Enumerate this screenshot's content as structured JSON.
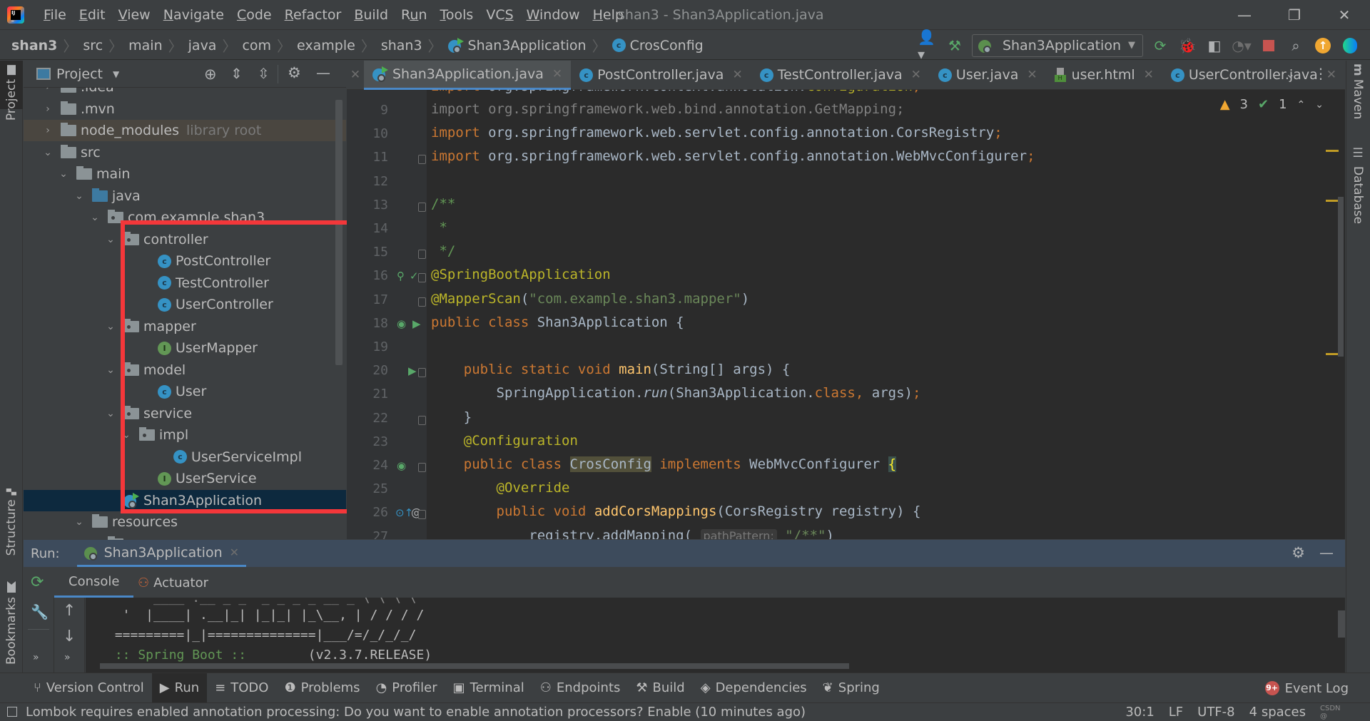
{
  "window": {
    "title": "shan3 - Shan3Application.java",
    "controls": [
      "—",
      "❐",
      "✕"
    ]
  },
  "menu": [
    {
      "label": "File",
      "mn": "F",
      "rest": "ile"
    },
    {
      "label": "Edit",
      "mn": "E",
      "rest": "dit"
    },
    {
      "label": "View",
      "mn": "V",
      "rest": "iew"
    },
    {
      "label": "Navigate",
      "mn": "N",
      "rest": "avigate"
    },
    {
      "label": "Code",
      "mn": "C",
      "rest": "ode"
    },
    {
      "label": "Refactor",
      "mn": "R",
      "rest": "efactor"
    },
    {
      "label": "Build",
      "mn": "B",
      "rest": "uild"
    },
    {
      "label": "Run",
      "mn": "u",
      "pre": "R",
      "rest": "n"
    },
    {
      "label": "Tools",
      "mn": "T",
      "rest": "ools"
    },
    {
      "label": "VCS",
      "pre": "VC",
      "mn": "S",
      "rest": ""
    },
    {
      "label": "Window",
      "mn": "W",
      "rest": "indow"
    },
    {
      "label": "Help",
      "mn": "H",
      "rest": "elp"
    }
  ],
  "breadcrumb": [
    "shan3",
    "src",
    "main",
    "java",
    "com",
    "example",
    "shan3",
    "Shan3Application",
    "CrosConfig"
  ],
  "toolbar": {
    "run_config": "Shan3Application",
    "icons": [
      "user-icon",
      "build-hammer-icon",
      "rerun-icon",
      "debug-icon",
      "coverage-icon",
      "profile-icon",
      "stop-icon",
      "search-icon",
      "update-icon",
      "plugin-icon"
    ]
  },
  "side_stripes": {
    "left_top": "Project",
    "left_structure": "Structure",
    "left_bookmarks": "Bookmarks",
    "right_maven": "Maven",
    "right_database": "Database"
  },
  "project_panel": {
    "title": "Project",
    "tree": [
      {
        "label": ".idea",
        "type": "folder",
        "depth": 1,
        "expanded": false,
        "partial": true
      },
      {
        "label": ".mvn",
        "type": "folder",
        "depth": 1,
        "expanded": false
      },
      {
        "label": "node_modules",
        "suffix": "library root",
        "type": "folder",
        "depth": 1,
        "expanded": false
      },
      {
        "label": "src",
        "type": "folder",
        "depth": 1,
        "expanded": true
      },
      {
        "label": "main",
        "type": "folder",
        "depth": 2,
        "expanded": true
      },
      {
        "label": "java",
        "type": "src-folder",
        "depth": 3,
        "expanded": true
      },
      {
        "label": "com.example.shan3",
        "type": "package",
        "depth": 4,
        "expanded": true
      },
      {
        "label": "controller",
        "type": "package",
        "depth": 5,
        "expanded": true
      },
      {
        "label": "PostController",
        "type": "class",
        "depth": 6
      },
      {
        "label": "TestController",
        "type": "class",
        "depth": 6
      },
      {
        "label": "UserController",
        "type": "class",
        "depth": 6
      },
      {
        "label": "mapper",
        "type": "package",
        "depth": 5,
        "expanded": true
      },
      {
        "label": "UserMapper",
        "type": "interface",
        "depth": 6
      },
      {
        "label": "model",
        "type": "package",
        "depth": 5,
        "expanded": true
      },
      {
        "label": "User",
        "type": "class",
        "depth": 6
      },
      {
        "label": "service",
        "type": "package",
        "depth": 5,
        "expanded": true
      },
      {
        "label": "impl",
        "type": "package",
        "depth": 6,
        "expanded": true
      },
      {
        "label": "UserServiceImpl",
        "type": "class",
        "depth": 7
      },
      {
        "label": "UserService",
        "type": "interface",
        "depth": 6
      },
      {
        "label": "Shan3Application",
        "type": "app",
        "depth": 5,
        "selected": true
      },
      {
        "label": "resources",
        "type": "folder",
        "depth": 3,
        "expanded": true
      },
      {
        "label": "mapper",
        "type": "folder",
        "depth": 4,
        "expanded": true
      }
    ]
  },
  "editor_tabs": [
    {
      "label": "Shan3Application.java",
      "icon": "app",
      "active": true
    },
    {
      "label": "PostController.java",
      "icon": "class"
    },
    {
      "label": "TestController.java",
      "icon": "class"
    },
    {
      "label": "User.java",
      "icon": "class"
    },
    {
      "label": "user.html",
      "icon": "html"
    },
    {
      "label": "UserController.java",
      "icon": "class"
    }
  ],
  "inspections": {
    "warnings": "3",
    "weak_warnings": "1"
  },
  "code_lines": [
    {
      "n": "9",
      "html": "<span class='gr'>import org.springframework.web.bind.annotation.GetMapping;</span>"
    },
    {
      "n": "10",
      "html": "<span class='kw'>import</span> org.springframework.web.servlet.config.annotation.CorsRegistry<span class='kw'>;</span>"
    },
    {
      "n": "11",
      "html": "<span class='kw'>import</span> org.springframework.web.servlet.config.annotation.WebMvcConfigurer<span class='kw'>;</span>"
    },
    {
      "n": "12",
      "html": ""
    },
    {
      "n": "13",
      "html": "<span class='cm'>/**</span>"
    },
    {
      "n": "14",
      "html": "<span class='cm'> *</span>"
    },
    {
      "n": "15",
      "html": "<span class='cm'> */</span>"
    },
    {
      "n": "16",
      "html": "<span class='an'>@SpringBootApplication</span>"
    },
    {
      "n": "17",
      "html": "<span class='an'>@MapperScan</span>(<span class='st'>\"com.example.shan3.mapper\"</span>)"
    },
    {
      "n": "18",
      "html": "<span class='kw'>public class</span> Shan3Application {"
    },
    {
      "n": "19",
      "html": ""
    },
    {
      "n": "20",
      "html": "    <span class='kw'>public static void</span> <span class='fn'>main</span>(String[] args) {"
    },
    {
      "n": "21",
      "html": "        SpringApplication.<span class='it'>run</span>(Shan3Application.<span class='kw'>class</span><span class='kw'>,</span> args)<span class='kw'>;</span>"
    },
    {
      "n": "22",
      "html": "    }"
    },
    {
      "n": "23",
      "html": "    <span class='an'>@Configuration</span>"
    },
    {
      "n": "24",
      "html": "    <span class='kw'>public class</span> <span class='hl'>CrosConfig</span> <span class='kw'>implements</span> WebMvcConfigurer <span class='br'>{</span>"
    },
    {
      "n": "25",
      "html": "        <span class='an'>@Override</span>"
    },
    {
      "n": "26",
      "html": "        <span class='kw'>public void</span> <span class='fn'>addCorsMappings</span>(CorsRegistry registry) {"
    },
    {
      "n": "27",
      "html": "            registry.addMapping( <span class='hint'>pathPattern:</span> <span class='st'>\"/**\"</span>)"
    }
  ],
  "run_window": {
    "label": "Run:",
    "tab": "Shan3Application",
    "subtabs": [
      "Console",
      "Actuator"
    ],
    "console_lines": [
      {
        "text": "  '  |____| .__|_| |_|_| |_\\__, | / / / /",
        "cls": ""
      },
      {
        "text": " =========|_|==============|___/=/_/_/_/",
        "cls": ""
      },
      {
        "text": " :: Spring Boot ::        (v2.3.7.RELEASE)",
        "cls": "boot"
      }
    ]
  },
  "tool_windows": [
    {
      "label": "Version Control",
      "icon": "⑂"
    },
    {
      "label": "Run",
      "icon": "▶",
      "active": true
    },
    {
      "label": "TODO",
      "icon": "≡"
    },
    {
      "label": "Problems",
      "icon": "❶"
    },
    {
      "label": "Profiler",
      "icon": "◔"
    },
    {
      "label": "Terminal",
      "icon": "▣"
    },
    {
      "label": "Endpoints",
      "icon": "⚇"
    },
    {
      "label": "Build",
      "icon": "⚒"
    },
    {
      "label": "Dependencies",
      "icon": "◈"
    },
    {
      "label": "Spring",
      "icon": "❦"
    }
  ],
  "event_log": {
    "label": "Event Log",
    "badge": "9+"
  },
  "status": {
    "message": "Lombok requires enabled annotation processing: Do you want to enable annotation processors? Enable (10 minutes ago)",
    "position": "30:1",
    "line_sep": "LF",
    "encoding": "UTF-8",
    "indent": "4 spaces",
    "watermark": "CSDN @"
  },
  "colors": {
    "accent": "#4a88c7",
    "highlight_box": "#f4373a",
    "selection": "#0d293e"
  }
}
